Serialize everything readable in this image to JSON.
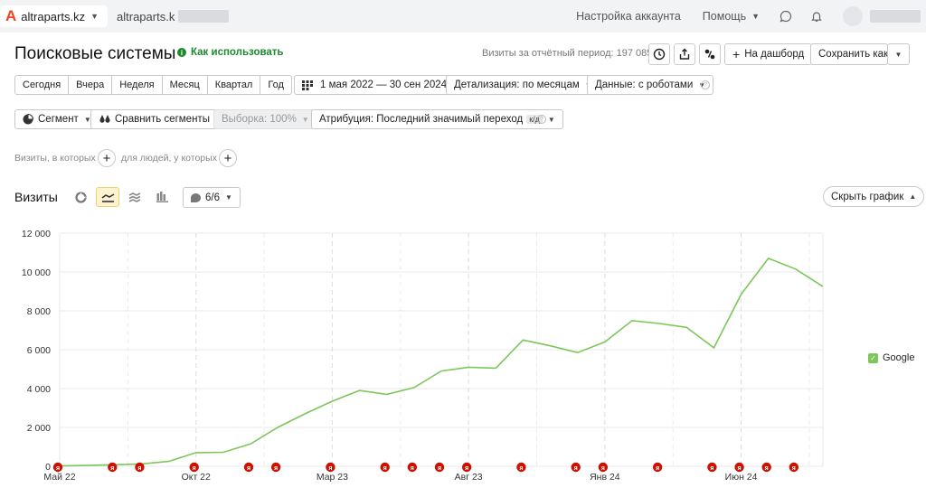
{
  "topbar": {
    "brand_logo": "A",
    "brand_name": "altraparts.kz",
    "site_name": "altraparts.k",
    "account_settings": "Настройка аккаунта",
    "help": "Помощь"
  },
  "header": {
    "title": "Поисковые системы",
    "howto": "Как использовать",
    "visits_total": "Визиты за отчётный период: 197 085",
    "dashboard_btn": "На дашборд",
    "save_as_btn": "Сохранить как"
  },
  "period": {
    "items": [
      "Сегодня",
      "Вчера",
      "Неделя",
      "Месяц",
      "Квартал",
      "Год"
    ],
    "range": "1 мая 2022 — 30 сен 2024",
    "detail": "Детализация: по месяцам",
    "data": "Данные: с роботами"
  },
  "segment": {
    "segment_btn": "Сегмент",
    "compare_btn": "Сравнить сегменты",
    "sample_btn": "Выборка: 100%",
    "attribution_btn": "Атрибуция: Последний значимый переход",
    "attribution_tag": "к/д"
  },
  "filters": {
    "visits_where": "Визиты, в которых",
    "people_where": "для людей, у которых"
  },
  "chart_header": {
    "title": "Визиты",
    "annotations_count": "6/6",
    "hide_chart": "Скрыть график"
  },
  "colors": {
    "line": "#7dc75a",
    "marker": "#cc1100",
    "grid": "#e8e8e8"
  },
  "chart_data": {
    "type": "line",
    "ylim": [
      0,
      12000
    ],
    "yticks": [
      "0",
      "2 000",
      "4 000",
      "6 000",
      "8 000",
      "10 000",
      "12 000"
    ],
    "x_tick_labels": [
      "Май 22",
      "Окт 22",
      "Мар 23",
      "Авг 23",
      "Янв 24",
      "Июн 24"
    ],
    "x": [
      "Май 22",
      "Июн 22",
      "Июл 22",
      "Авг 22",
      "Сен 22",
      "Окт 22",
      "Ноя 22",
      "Дек 22",
      "Янв 23",
      "Фев 23",
      "Мар 23",
      "Апр 23",
      "Май 23",
      "Июн 23",
      "Июл 23",
      "Авг 23",
      "Сен 23",
      "Окт 23",
      "Ноя 23",
      "Дек 23",
      "Янв 24",
      "Фев 24",
      "Мар 24",
      "Апр 24",
      "Май 24",
      "Июн 24",
      "Июл 24",
      "Авг 24",
      "Сен 24"
    ],
    "series": [
      {
        "name": "Google",
        "values": [
          20,
          40,
          80,
          120,
          250,
          700,
          720,
          1150,
          2000,
          2700,
          3350,
          3900,
          3700,
          4050,
          4900,
          5100,
          5050,
          6500,
          6200,
          5850,
          6400,
          7500,
          7350,
          7150,
          6100,
          8850,
          10700,
          10150,
          9250
        ]
      }
    ],
    "annotation_month_indexes": [
      0,
      2,
      3,
      5,
      7,
      8,
      10,
      12,
      13,
      14,
      15,
      17,
      19,
      20,
      22,
      24,
      25,
      26,
      27
    ]
  }
}
